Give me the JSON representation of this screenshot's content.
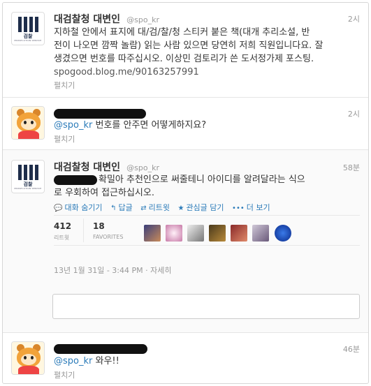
{
  "tweets": [
    {
      "name": "대검찰청 대변인",
      "handle": "@spo_kr",
      "time": "2시",
      "text_line1": "지하철 안에서 표지에 대/검/찰/청 스티커 붙은 책(대개 추리소설, 반",
      "text_line2": "전이 나오면 깜짝 놀람) 읽는 사람 있으면 당연히 저희 직원입니다요. 잘",
      "text_line3": "생겼으면 번호를 따주십시오. 이상민 검토리가 쓴 도서정가제 포스팅.",
      "link": "spogood.blog.me/90163257991",
      "expand": "펼치기",
      "avatar_logo": "검찰",
      "avatar_logo_sub": "PROSECUTION SERVICE"
    },
    {
      "time": "2시",
      "mention": "@spo_kr",
      "text": "번호를 안주면 어떻게하지요?",
      "expand": "펼치기"
    },
    {
      "name": "대검찰청 대변인",
      "handle": "@spo_kr",
      "time": "58분",
      "text_line1": "확밀아 추천인으로 써줄테니 아이디를 알려달라는 식으",
      "text_line2": "로 우회하여 접근하십시오.",
      "avatar_logo": "검찰",
      "avatar_logo_sub": "PROSECUTION SERVICE",
      "actions": {
        "hide_conversation": "대화 숨기기",
        "reply": "답글",
        "retweet": "리트윗",
        "favorite": "관심글 담기",
        "more": "더 보기"
      },
      "retweets_count": "412",
      "retweets_label": "리트윗",
      "favorites_count": "18",
      "favorites_label": "FAVORITES",
      "full_timestamp": "13년 1월 31일 - 3:44 PM",
      "details_link": "자세히"
    },
    {
      "time": "46분",
      "mention": "@spo_kr",
      "text": "와우!!",
      "expand": "펼치기"
    }
  ],
  "colors": {
    "link_blue": "#2b7bb9",
    "muted_gray": "#999999",
    "logo_navy": "#1e2d4a"
  },
  "icons": {
    "hide_conversation": "speech-bubble-icon",
    "reply": "reply-arrow-icon",
    "retweet": "retweet-icon",
    "favorite": "star-icon",
    "more": "ellipsis-icon"
  }
}
